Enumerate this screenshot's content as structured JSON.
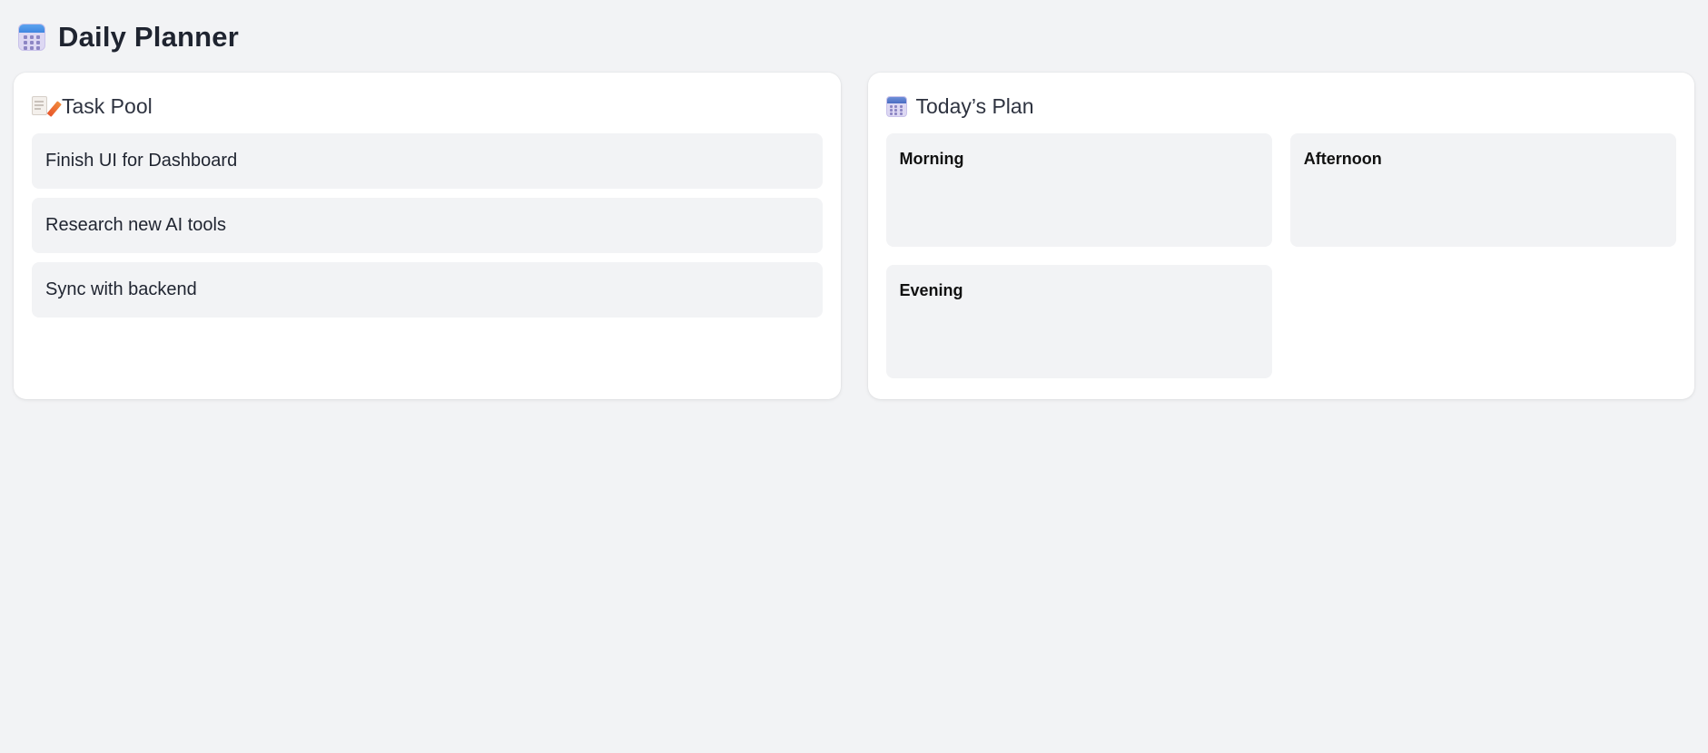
{
  "header": {
    "title": "Daily Planner",
    "icon": "calendar-icon"
  },
  "task_pool": {
    "title": "Task Pool",
    "icon": "memo-icon",
    "tasks": [
      {
        "label": "Finish UI for Dashboard"
      },
      {
        "label": "Research new AI tools"
      },
      {
        "label": "Sync with backend"
      }
    ]
  },
  "plan": {
    "title": "Today’s Plan",
    "icon": "calendar-icon",
    "slots": [
      {
        "label": "Morning"
      },
      {
        "label": "Afternoon"
      },
      {
        "label": "Evening"
      }
    ]
  },
  "colors": {
    "background": "#f2f3f5",
    "card": "#ffffff",
    "item": "#f2f3f5",
    "text": "#1f2430"
  }
}
